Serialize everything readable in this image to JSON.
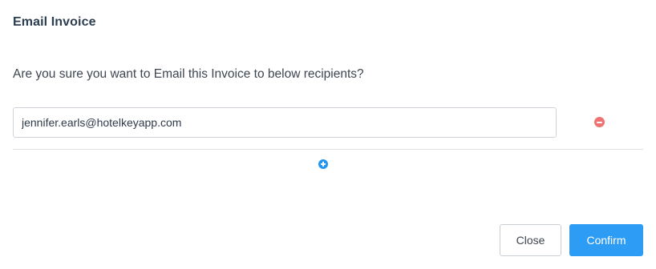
{
  "dialog": {
    "title": "Email Invoice",
    "message": "Are you sure you want to Email this Invoice to below recipients?"
  },
  "recipients": [
    {
      "email": "jennifer.earls@hotelkeyapp.com"
    }
  ],
  "icons": {
    "remove": "minus-circle-icon",
    "add": "plus-circle-icon"
  },
  "actions": {
    "close_label": "Close",
    "confirm_label": "Confirm"
  },
  "colors": {
    "accent": "#2d9cf4",
    "add_icon": "#2196f3",
    "remove_icon": "#f07373"
  }
}
